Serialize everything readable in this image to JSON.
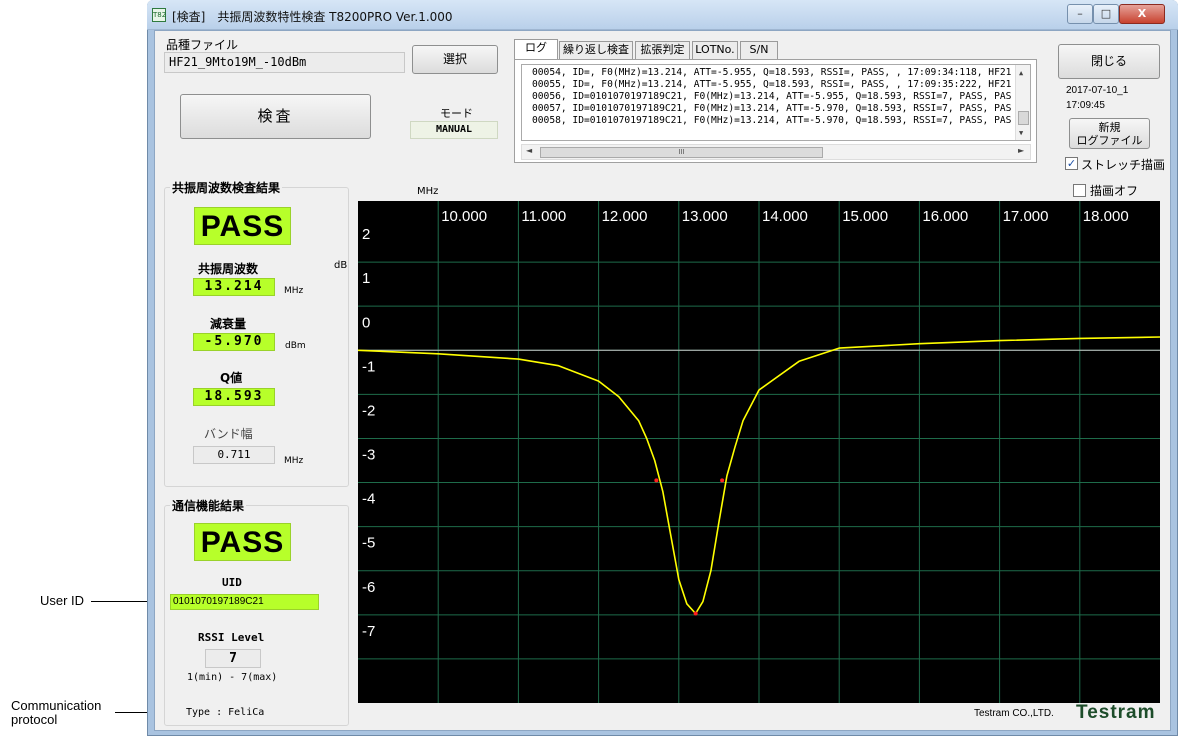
{
  "window": {
    "title": "[検査]　共振周波数特性検査 T8200PRO Ver.1.000",
    "app_icon": "T82",
    "controls": {
      "minimize": "–",
      "maximize": "□",
      "close": "X"
    }
  },
  "file": {
    "label": "品種ファイル",
    "value": "HF21_9Mto19M_-10dBm",
    "select_button": "選択"
  },
  "inspect_button": "検査",
  "mode": {
    "label": "モード",
    "value": "MANUAL"
  },
  "tabs": [
    "ログ",
    "繰り返し検査",
    "拡張判定",
    "LOTNo.",
    "S/N"
  ],
  "log": {
    "lines": [
      "00054, ID=, F0(MHz)=13.214, ATT=-5.955, Q=18.593, RSSI=, PASS, , 17:09:34:118, HF21",
      "00055, ID=, F0(MHz)=13.214, ATT=-5.955, Q=18.593, RSSI=, PASS, , 17:09:35:222, HF21",
      "00056, ID=0101070197189C21, F0(MHz)=13.214, ATT=-5.955, Q=18.593, RSSI=7, PASS, PAS",
      "00057, ID=0101070197189C21, F0(MHz)=13.214, ATT=-5.970, Q=18.593, RSSI=7, PASS, PAS",
      "00058, ID=0101070197189C21, F0(MHz)=13.214, ATT=-5.970, Q=18.593, RSSI=7, PASS, PAS"
    ],
    "scroll_mid": "III"
  },
  "right_panel": {
    "close_button": "閉じる",
    "date": "2017-07-10_1",
    "time": "17:09:45",
    "new_log_button_line1": "新規",
    "new_log_button_line2": "ログファイル",
    "stretch_label": "ストレッチ描画",
    "stretch_checked": true,
    "drawing_off_label": "描画オフ",
    "drawing_off_checked": false
  },
  "resonance": {
    "title": "共振周波数検査結果",
    "result": "PASS",
    "freq_label": "共振周波数",
    "freq_value": "13.214",
    "freq_unit": "MHz",
    "att_label": "減衰量",
    "att_value": "-5.970",
    "att_unit": "dBm",
    "q_label": "Q値",
    "q_value": "18.593",
    "bw_label": "バンド幅",
    "bw_value": "0.711",
    "bw_unit": "MHz"
  },
  "comm": {
    "title": "通信機能結果",
    "result": "PASS",
    "uid_label": "UID",
    "uid_value": "0101070197189C21",
    "rssi_label": "RSSI Level",
    "rssi_value": "7",
    "rssi_range": "1(min) - 7(max)",
    "type_text": "Type : FeliCa"
  },
  "annotations": {
    "user_id": "User ID",
    "comm_protocol_line1": "Communication",
    "comm_protocol_line2": "protocol"
  },
  "footer": {
    "company": "Testram CO.,LTD.",
    "logo": "Testram"
  },
  "chart_data": {
    "type": "line",
    "xlabel": "MHz",
    "ylabel": "dB",
    "x_ticks": [
      "10.000",
      "11.000",
      "12.000",
      "13.000",
      "14.000",
      "15.000",
      "16.000",
      "17.000",
      "18.000"
    ],
    "y_ticks": [
      "2",
      "1",
      "0",
      "-1",
      "-2",
      "-3",
      "-4",
      "-5",
      "-6",
      "-7"
    ],
    "xlim": [
      9.0,
      19.0
    ],
    "ylim": [
      -8.0,
      3.0
    ],
    "grid": true,
    "series": [
      {
        "color": "#ffff00",
        "x": [
          9.0,
          10.0,
          11.0,
          11.5,
          12.0,
          12.25,
          12.5,
          12.6,
          12.7,
          12.8,
          12.9,
          13.0,
          13.1,
          13.21,
          13.3,
          13.4,
          13.5,
          13.6,
          13.7,
          13.8,
          14.0,
          14.5,
          15.0,
          16.0,
          17.0,
          18.0,
          19.0
        ],
        "y": [
          0.0,
          -0.08,
          -0.2,
          -0.35,
          -0.7,
          -1.05,
          -1.6,
          -2.0,
          -2.5,
          -3.2,
          -4.2,
          -5.2,
          -5.75,
          -5.97,
          -5.7,
          -5.0,
          -3.9,
          -2.85,
          -2.2,
          -1.6,
          -0.9,
          -0.25,
          0.05,
          0.15,
          0.22,
          0.27,
          0.3
        ]
      }
    ],
    "markers": [
      {
        "x": 12.72,
        "y": -2.95,
        "color": "#ff2020"
      },
      {
        "x": 13.54,
        "y": -2.95,
        "color": "#ff2020"
      },
      {
        "x": 13.21,
        "y": -5.97,
        "color": "#ff2020"
      }
    ],
    "reference_line_y": 0,
    "reference_color": "#c8c8c8",
    "grid_color": "#1e6b4a",
    "background": "#000000"
  }
}
